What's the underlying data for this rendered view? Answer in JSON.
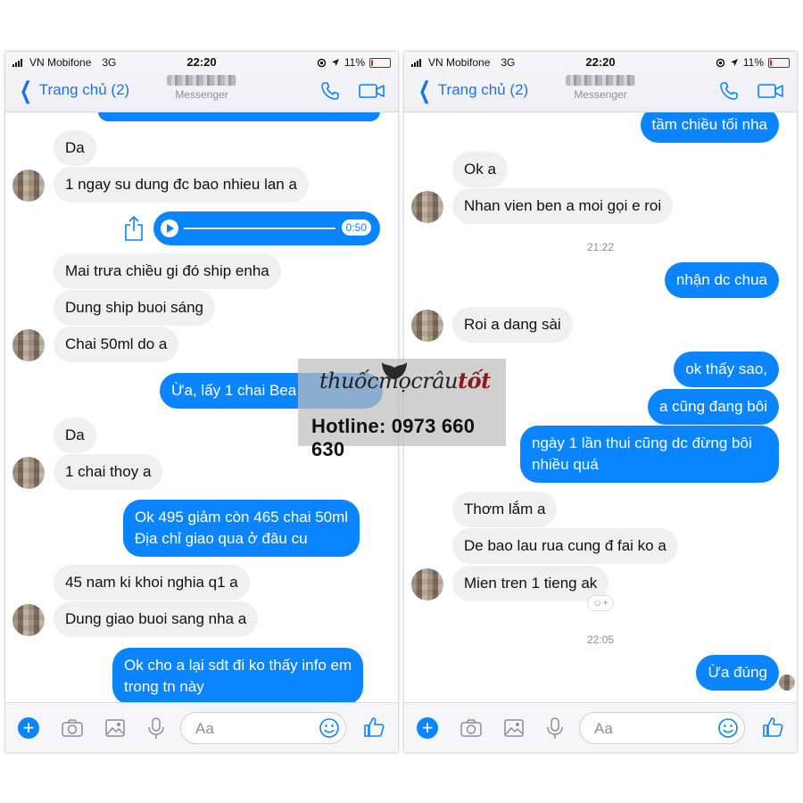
{
  "status_bar": {
    "carrier": "VN Mobifone",
    "network": "3G",
    "time": "22:20",
    "battery": "11%",
    "battery_level": 0.11
  },
  "header": {
    "back_label": "Trang chủ (2)",
    "subtitle": "Messenger"
  },
  "left_chat": {
    "audio_duration": "0:50",
    "messages": [
      {
        "side": "in",
        "text": "Da"
      },
      {
        "side": "in",
        "text": "1 ngay su dung đc bao nhieu lan a"
      },
      {
        "side": "in",
        "text": "Mai trưa chiều gi đó ship enha"
      },
      {
        "side": "in",
        "text": "Dung ship buoi sáng"
      },
      {
        "side": "in",
        "text": "Chai 50ml do a"
      },
      {
        "side": "out",
        "text": "Ừa, lấy 1 chai Bea"
      },
      {
        "side": "in",
        "text": "Da"
      },
      {
        "side": "in",
        "text": "1 chai thoy a"
      },
      {
        "side": "out",
        "text": "Ok 495 giảm còn 465 chai 50ml\nĐịa chỉ giao qua ở đâu cu"
      },
      {
        "side": "in",
        "text": "45 nam ki khoi nghia q1 a"
      },
      {
        "side": "in",
        "text": "Dung giao buoi sang nha a"
      },
      {
        "side": "out",
        "text": "Ok cho a lại sdt đi ko thấy info em\ntrong tn này"
      }
    ]
  },
  "right_chat": {
    "timestamps": [
      "21:22",
      "22:05"
    ],
    "messages": [
      {
        "side": "out",
        "text": "tầm chiều tối nha"
      },
      {
        "side": "in",
        "text": "Ok a"
      },
      {
        "side": "in",
        "text": "Nhan vien ben a moi gọi e roi"
      },
      {
        "side": "out",
        "text": "nhận dc chua"
      },
      {
        "side": "in",
        "text": "Roi a dang sài"
      },
      {
        "side": "out",
        "text": "ok thấy sao,"
      },
      {
        "side": "out",
        "text": "a cũng đang bôi"
      },
      {
        "side": "out",
        "text": "ngày 1 lần thui cũng dc đừng bôi\nnhiều quá"
      },
      {
        "side": "in",
        "text": "Thơm lắm a"
      },
      {
        "side": "in",
        "text": "De bao lau rua cung đ fai ko a"
      },
      {
        "side": "in",
        "text": "Mien tren 1 tieng ak"
      },
      {
        "side": "out",
        "text": "Ừa đúng"
      }
    ]
  },
  "composer": {
    "placeholder": "Aa"
  },
  "watermark": {
    "brand": "thuốcmọcrâutốt",
    "brand_main": "thuốcmọcrâu",
    "brand_accent": "tốt",
    "hotline": "Hotline: 0973 660 630"
  },
  "colors": {
    "accent": "#0a84ff",
    "incoming_bubble": "#f0f0f0",
    "battery_low": "#e0271d"
  },
  "icons": [
    "back-chevron-icon",
    "phone-icon",
    "video-camera-icon",
    "share-icon",
    "play-icon",
    "plus-icon",
    "camera-icon",
    "image-icon",
    "microphone-icon",
    "smile-icon",
    "thumbs-up-icon",
    "beard-logo-icon"
  ]
}
